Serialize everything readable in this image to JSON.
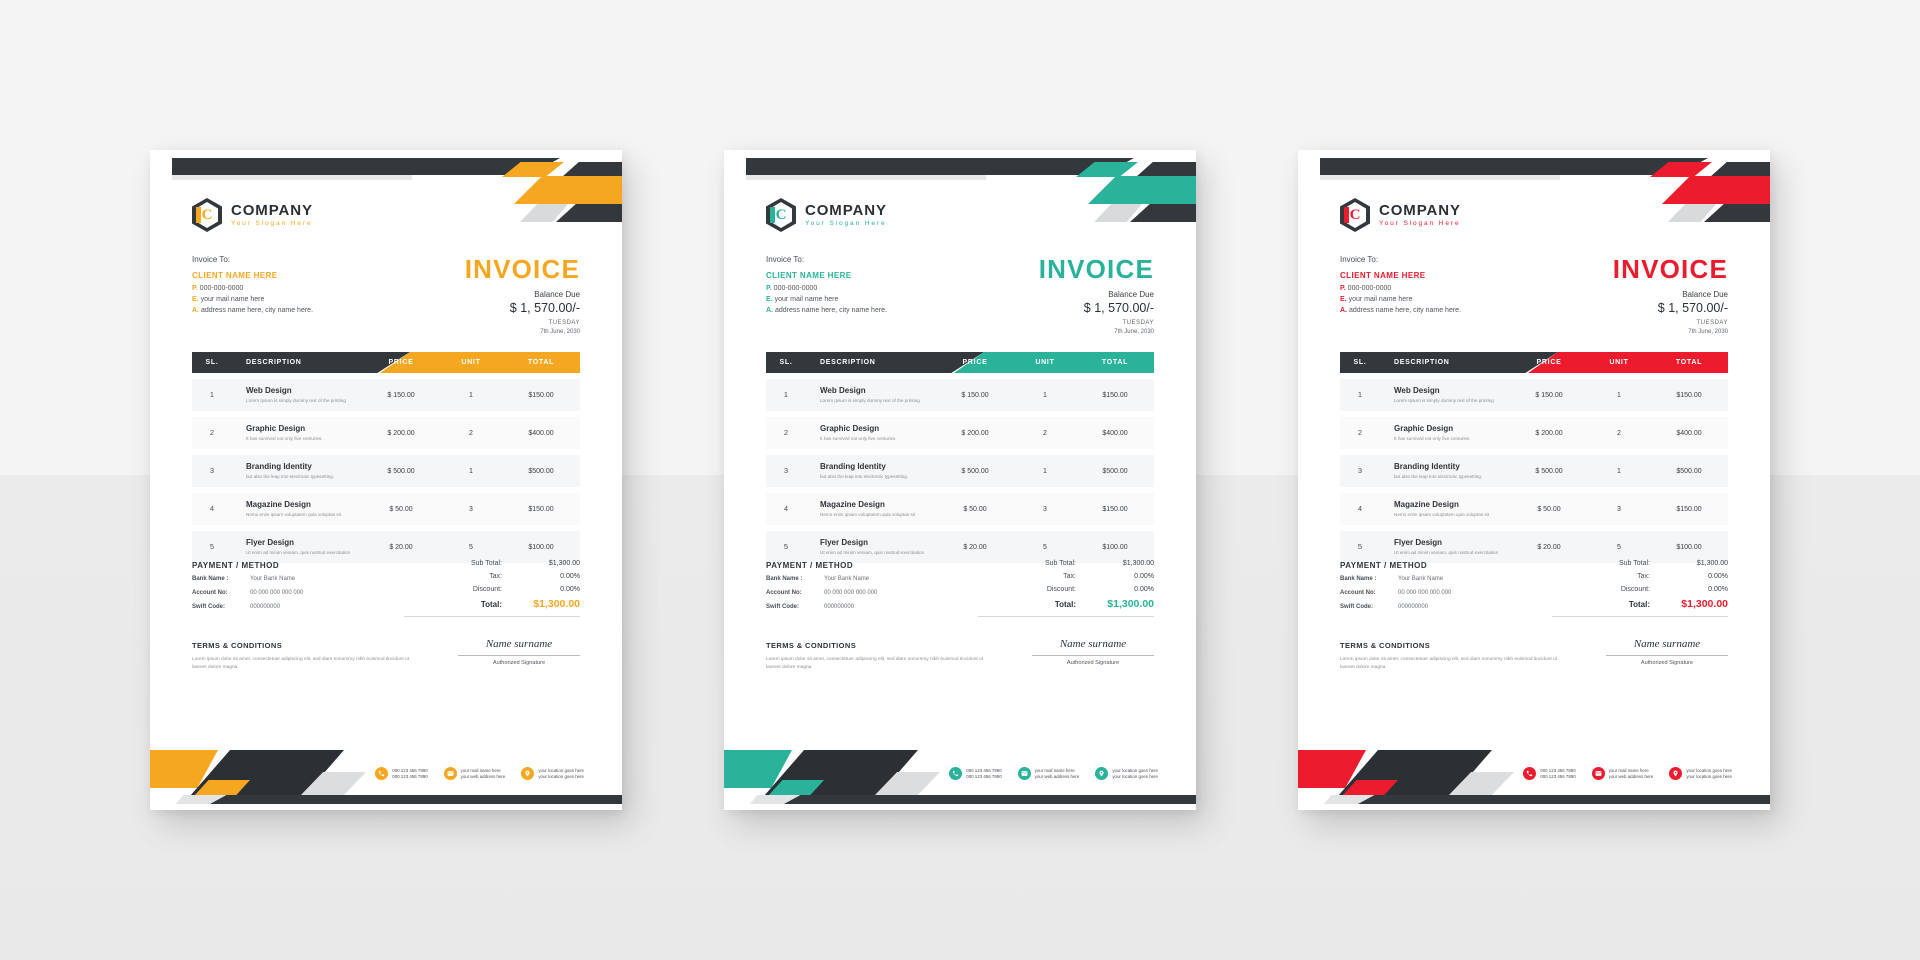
{
  "meta": {
    "variants": [
      {
        "id": "yellow",
        "accent": "#F6A721"
      },
      {
        "id": "teal",
        "accent": "#2BB29A"
      },
      {
        "id": "red",
        "accent": "#EC1C2E"
      }
    ]
  },
  "brand": {
    "name": "COMPANY",
    "slogan": "Your Slogan Here",
    "logo_letter": "C"
  },
  "billing": {
    "label": "Invoice To:",
    "client": "CLIENT NAME HERE",
    "phone_key": "P.",
    "phone": "000-000-0000",
    "email_key": "E.",
    "email": "your mail name here",
    "address_key": "A.",
    "address": "address name here, city name here."
  },
  "title": {
    "heading": "INVOICE",
    "balance_label": "Balance Due",
    "balance_amount": "$ 1, 570.00/-",
    "day": "TUESDAY",
    "date": "7th June, 2030"
  },
  "table": {
    "headers": {
      "sl": "SL.",
      "description": "DESCRIPTION",
      "price": "PRICE",
      "unit": "UNIT",
      "total": "TOTAL"
    },
    "rows": [
      {
        "sl": "1",
        "title": "Web Design",
        "sub": "Lorem Ipsum is simply dummy text of the printing",
        "price": "$ 150.00",
        "unit": "1",
        "total": "$150.00"
      },
      {
        "sl": "2",
        "title": "Graphic Design",
        "sub": "It has survived not only five centuries.",
        "price": "$ 200.00",
        "unit": "2",
        "total": "$400.00"
      },
      {
        "sl": "3",
        "title": "Branding Identity",
        "sub": "but also the leap into electronic typesetting.",
        "price": "$ 500.00",
        "unit": "1",
        "total": "$500.00"
      },
      {
        "sl": "4",
        "title": "Magazine Design",
        "sub": "Nemo enim ipsam voluptatem quia voluptas sit",
        "price": "$ 50.00",
        "unit": "3",
        "total": "$150.00"
      },
      {
        "sl": "5",
        "title": "Flyer Design",
        "sub": "Ut enim ad minim veniam, quis nostrud exercitation",
        "price": "$ 20.00",
        "unit": "5",
        "total": "$100.00"
      }
    ]
  },
  "payment": {
    "heading": "PAYMENT / METHOD",
    "bank_label": "Bank Name :",
    "bank_value": "Your Bank Name",
    "account_label": "Account No:",
    "account_value": "00 000 000 000 000",
    "swift_label": "Swift Code:",
    "swift_value": "000000000"
  },
  "totals": {
    "subtotal_label": "Sub Total:",
    "subtotal_value": "$1,300.00",
    "tax_label": "Tax:",
    "tax_value": "0.00%",
    "discount_label": "Discount:",
    "discount_value": "0.00%",
    "total_label": "Total:",
    "total_value": "$1,300.00"
  },
  "terms": {
    "heading": "TERMS & CONDITIONS",
    "body": "Lorem ipsum dolor sit amet, consectetuer adipiscing elit, sed diam nonummy nibh euismod tincidunt ut laoreet dolore magna."
  },
  "signature": {
    "name": "Name surname",
    "caption": "Authorized Signature"
  },
  "footer": {
    "contacts": [
      {
        "icon": "phone-icon",
        "line1": "000 123 456 7890",
        "line2": "000 123 456 7890"
      },
      {
        "icon": "mail-icon",
        "line1": "your mail name here",
        "line2": "your web address here"
      },
      {
        "icon": "location-icon",
        "line1": "your location goes here",
        "line2": "your location goes here"
      }
    ]
  }
}
